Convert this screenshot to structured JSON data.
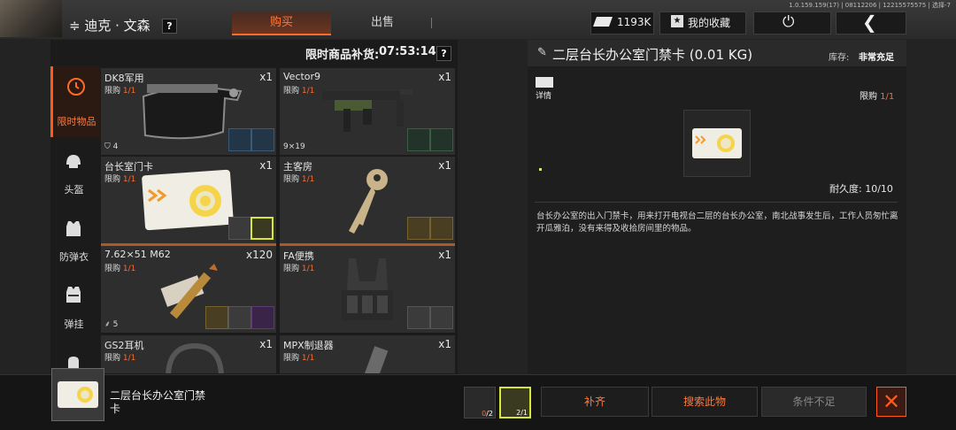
{
  "topbar": {
    "player_name": "≑ 迪克 · 文森",
    "help": "?",
    "tabs": [
      {
        "label": "购买",
        "active": true
      },
      {
        "label": "出售",
        "active": false
      }
    ],
    "version": "1.0.159.159(17) | 08112206 | 12215575575 | 选择-7",
    "currency_value": "1193K",
    "favorites_label": "我的收藏",
    "power_icon": "⏻",
    "back_icon": "❮"
  },
  "restock": {
    "label": "限时商品补货:",
    "time": "07:53:14",
    "help": "?"
  },
  "categories": [
    {
      "label": "限时物品",
      "icon": "clock-icon",
      "active": true
    },
    {
      "label": "头盔",
      "icon": "helmet-icon",
      "active": false
    },
    {
      "label": "防弹衣",
      "icon": "vest-icon",
      "active": false
    },
    {
      "label": "弹挂",
      "icon": "rig-icon",
      "active": false
    }
  ],
  "items": [
    {
      "name": "DK8军用",
      "qty": "x1",
      "limit_label": "限购",
      "limit": "1/1",
      "foot": "4"
    },
    {
      "name": "Vector9",
      "qty": "x1",
      "limit_label": "限购",
      "limit": "1/1",
      "foot": "9×19"
    },
    {
      "name": "台长室门卡",
      "qty": "x1",
      "limit_label": "限购",
      "limit": "1/1",
      "foot": ""
    },
    {
      "name": "主客房",
      "qty": "x1",
      "limit_label": "限购",
      "limit": "1/1",
      "foot": ""
    },
    {
      "name": "7.62×51 M62",
      "qty": "x120",
      "limit_label": "限购",
      "limit": "1/1",
      "foot": "5"
    },
    {
      "name": "FA便携",
      "qty": "x1",
      "limit_label": "限购",
      "limit": "1/1",
      "foot": ""
    },
    {
      "name": "GS2耳机",
      "qty": "x1",
      "limit_label": "限购",
      "limit": "1/1",
      "foot": ""
    },
    {
      "name": "MPX制退器",
      "qty": "x1",
      "limit_label": "限购",
      "limit": "1/1",
      "foot": ""
    }
  ],
  "detail": {
    "title": "二层台长办公室门禁卡 (0.01 KG)",
    "stock_label": "库存:",
    "stock_value": "非常充足",
    "info_label": "详情",
    "limit_label": "限购",
    "limit_value": "1/1",
    "durability": "耐久度:  10/10",
    "description": "台长办公室的出入门禁卡，用来打开电视台二层的台长办公室，南北战事发生后，工作人员匆忙离开瓜雅泊，没有来得及收拾房间里的物品。"
  },
  "bottom": {
    "selected_name": "二层台长办公室门禁卡",
    "requirements": [
      {
        "count_have": "0",
        "count_need": "/2"
      },
      {
        "count": "2/1"
      }
    ],
    "replenish_label": "补齐",
    "search_label": "搜索此物",
    "condition_label": "条件不足",
    "close_icon": "✕"
  },
  "colors": {
    "accent": "#ff6a2a",
    "highlight": "#d8e63a"
  }
}
